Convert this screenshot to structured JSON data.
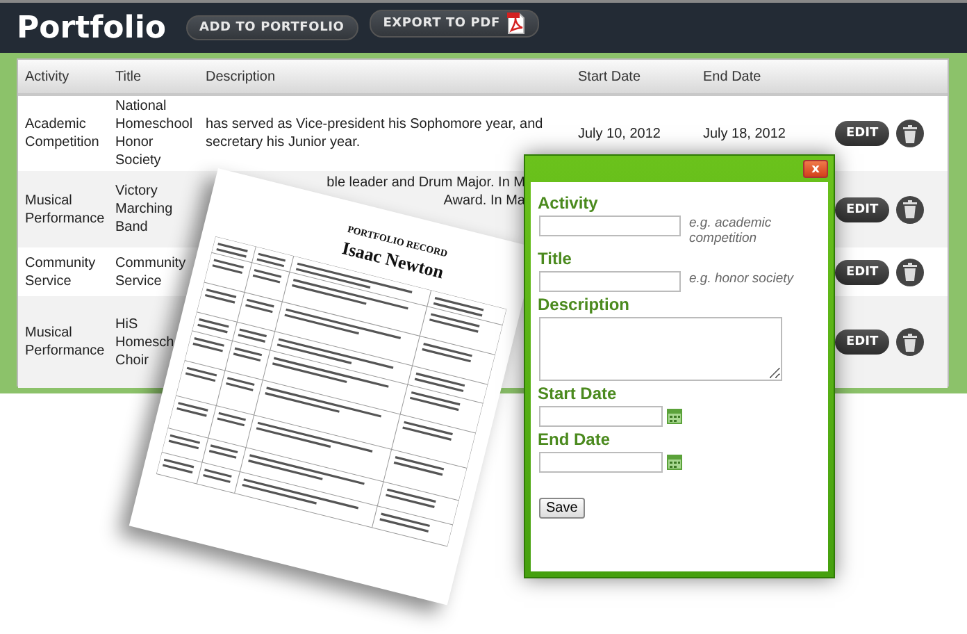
{
  "header": {
    "title": "Portfolio",
    "buttons": [
      {
        "label": "ADD TO PORTFOLIO",
        "kind": "plain"
      },
      {
        "label": "EXPORT TO PDF",
        "kind": "pdf"
      }
    ]
  },
  "table": {
    "columns": [
      "Activity",
      "Title",
      "Description",
      "Start Date",
      "End Date"
    ],
    "rows": [
      {
        "activity": [
          "Academic",
          "Competition"
        ],
        "title": [
          "National",
          "Homeschool",
          "Honor",
          "Society"
        ],
        "description": [
          "has served as Vice-president his Sophomore year, and",
          "secretary his Junior year."
        ],
        "start": "July 10, 2012",
        "end": "July 18, 2012",
        "edit": "EDIT"
      },
      {
        "activity": [
          "Musical",
          "Performance"
        ],
        "title": [
          "Victory",
          "Marching",
          "Band"
        ],
        "description": [
          "ble leader and Drum Major. In M",
          "Award. In Ma"
        ],
        "edit": "EDIT"
      },
      {
        "activity": [
          "Community",
          "Service"
        ],
        "title": [
          "Community",
          "Service"
        ],
        "edit": "EDIT"
      },
      {
        "activity": [
          "Musical",
          "Performance"
        ],
        "title": [
          "HiS",
          "Homesch",
          "Choir"
        ],
        "edit": "EDIT"
      }
    ]
  },
  "document": {
    "kind": "document",
    "heading": "PORTFOLIO RECORD",
    "name": "Isaac Newton"
  },
  "dialog": {
    "close": "x",
    "fields": [
      {
        "label": "Activity",
        "kind": "text",
        "hint": "e.g. academic competition"
      },
      {
        "label": "Title",
        "kind": "text",
        "hint": "e.g. honor society"
      },
      {
        "label": "Description",
        "kind": "textarea"
      },
      {
        "label": "Start Date",
        "kind": "date"
      },
      {
        "label": "End Date",
        "kind": "date"
      }
    ],
    "submit": "Save"
  }
}
